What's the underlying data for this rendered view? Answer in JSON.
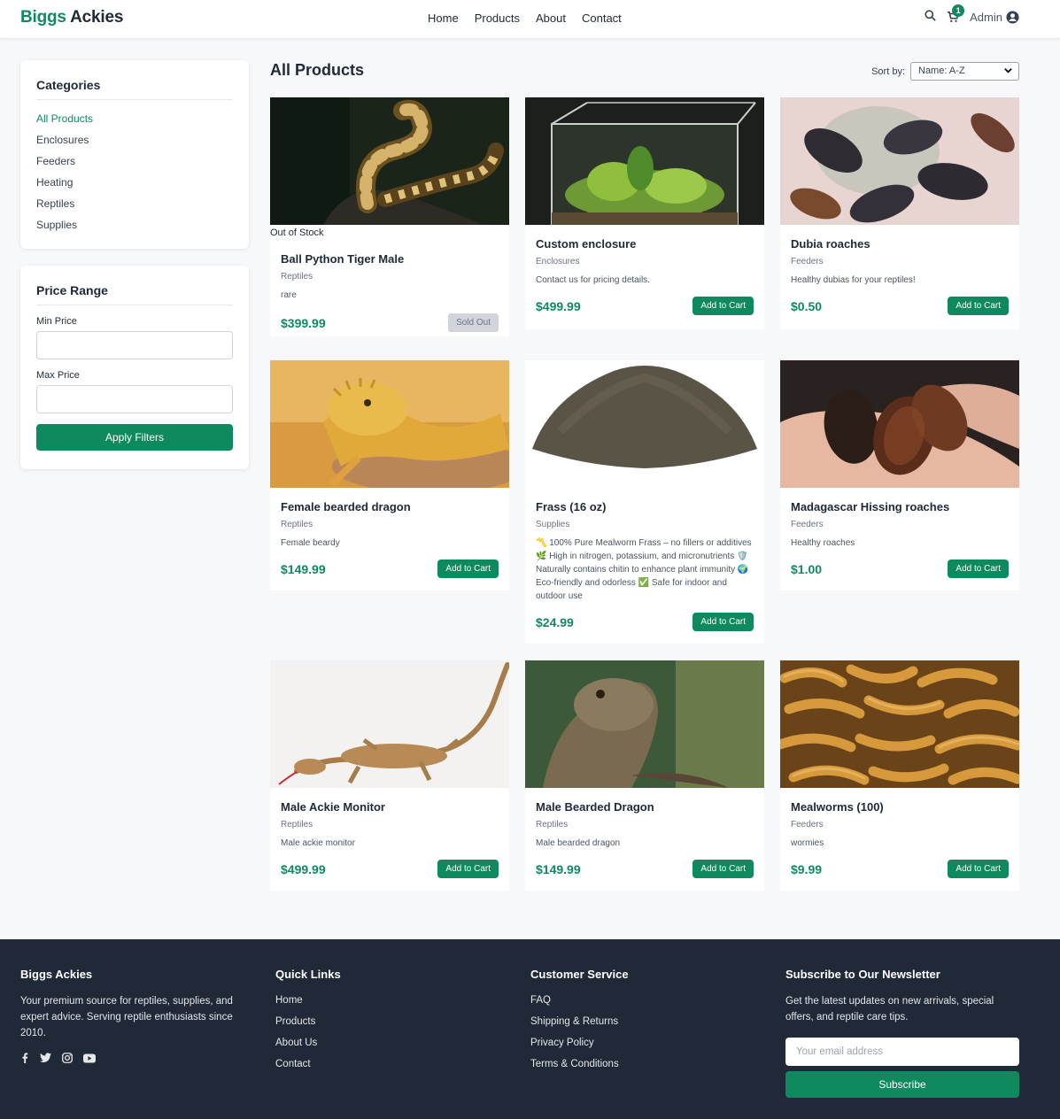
{
  "header": {
    "logo_part1": "Biggs",
    "logo_part2": "Ackies",
    "nav": [
      "Home",
      "Products",
      "About",
      "Contact"
    ],
    "cart_count": "1",
    "user_label": "Admin"
  },
  "sidebar": {
    "categories_title": "Categories",
    "categories": [
      "All Products",
      "Enclosures",
      "Feeders",
      "Heating",
      "Reptiles",
      "Supplies"
    ],
    "active_category": "All Products",
    "price_title": "Price Range",
    "min_label": "Min Price",
    "max_label": "Max Price",
    "min_value": "",
    "max_value": "",
    "apply_label": "Apply Filters"
  },
  "main": {
    "title": "All Products",
    "sort_label": "Sort by:",
    "sort_value": "Name: A-Z",
    "add_label": "Add to Cart",
    "products": [
      {
        "name": "Ball Python Tiger Male",
        "category": "Reptiles",
        "description": "rare",
        "price": "$399.99",
        "status": "Out of Stock",
        "action": "Sold Out"
      },
      {
        "name": "Custom enclosure",
        "category": "Enclosures",
        "description": "Contact us for pricing details.",
        "price": "$499.99"
      },
      {
        "name": "Dubia roaches",
        "category": "Feeders",
        "description": "Healthy dubias for your reptiles!",
        "price": "$0.50"
      },
      {
        "name": "Female bearded dragon",
        "category": "Reptiles",
        "description": "Female beardy",
        "price": "$149.99"
      },
      {
        "name": "Frass (16 oz)",
        "category": "Supplies",
        "description": "〽️ 100% Pure Mealworm Frass – no fillers or additives 🌿 High in nitrogen, potassium, and micronutrients 🛡️ Naturally contains chitin to enhance plant immunity 🌍 Eco-friendly and odorless ✅ Safe for indoor and outdoor use",
        "price": "$24.99"
      },
      {
        "name": "Madagascar Hissing roaches",
        "category": "Feeders",
        "description": "Healthy roaches",
        "price": "$1.00"
      },
      {
        "name": "Male Ackie Monitor",
        "category": "Reptiles",
        "description": "Male ackie monitor",
        "price": "$499.99"
      },
      {
        "name": "Male Bearded Dragon",
        "category": "Reptiles",
        "description": "Male bearded dragon",
        "price": "$149.99"
      },
      {
        "name": "Mealworms (100)",
        "category": "Feeders",
        "description": "wormies",
        "price": "$9.99"
      }
    ]
  },
  "footer": {
    "brand": "Biggs Ackies",
    "about": "Your premium source for reptiles, supplies, and expert advice. Serving reptile enthusiasts since 2010.",
    "social_icons": [
      "facebook-icon",
      "twitter-icon",
      "instagram-icon",
      "youtube-icon"
    ],
    "quick_title": "Quick Links",
    "quick_links": [
      "Home",
      "Products",
      "About Us",
      "Contact"
    ],
    "service_title": "Customer Service",
    "service_links": [
      "FAQ",
      "Shipping & Returns",
      "Privacy Policy",
      "Terms & Conditions"
    ],
    "newsletter_title": "Subscribe to Our Newsletter",
    "newsletter_text": "Get the latest updates on new arrivals, special offers, and reptile care tips.",
    "email_placeholder": "Your email address",
    "subscribe_label": "Subscribe"
  },
  "colors": {
    "brand": "#0f8a5f",
    "footer_bg": "#1f2937",
    "sold_out": "#d1d5db"
  }
}
